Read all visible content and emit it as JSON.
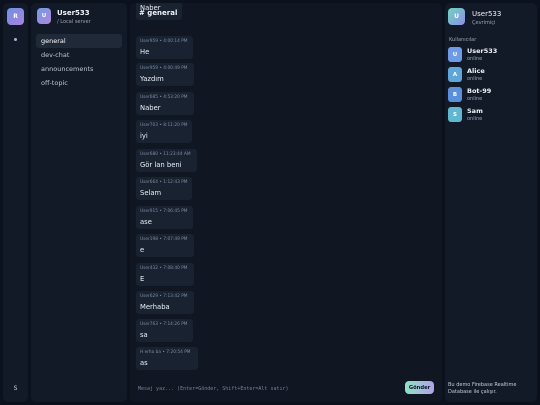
{
  "rail": {
    "server_initial": "R",
    "bottom_label": "S"
  },
  "sidebar": {
    "user_initial": "U",
    "username": "User533",
    "server_label": "/ Local server",
    "channels": [
      {
        "label": "general",
        "active": true
      },
      {
        "label": "dev-chat",
        "active": false
      },
      {
        "label": "announcements",
        "active": false
      },
      {
        "label": "off-topic",
        "active": false
      }
    ]
  },
  "main": {
    "title": "# general",
    "messages": [
      {
        "meta": "",
        "text": "Naber"
      },
      {
        "meta": "User959 • 4:00:14 PM",
        "text": "He"
      },
      {
        "meta": "User959 • 4:00:49 PM",
        "text": "Yazdım"
      },
      {
        "meta": "User685 • 4:53:20 PM",
        "text": "Naber"
      },
      {
        "meta": "User703 • 8:11:20 PM",
        "text": "iyi"
      },
      {
        "meta": "User680 • 11:23:44 AM",
        "text": "Gör lan beni"
      },
      {
        "meta": "User664 • 1:12:43 PM",
        "text": "Selam"
      },
      {
        "meta": "User915 • 7:06:45 PM",
        "text": "ase"
      },
      {
        "meta": "User198 • 7:07:49 PM",
        "text": "e"
      },
      {
        "meta": "User432 • 7:08:40 PM",
        "text": "E"
      },
      {
        "meta": "User629 • 7:13:42 PM",
        "text": "Merhaba"
      },
      {
        "meta": "User763 • 7:14:26 PM",
        "text": "sa"
      },
      {
        "meta": "H erha ba • 7:20:54 PM",
        "text": "as"
      }
    ],
    "composer": {
      "placeholder": "Mesaj yaz... (Enter=Gönder, Shift+Enter=Alt satır)",
      "send_label": "Gönder"
    }
  },
  "right_panel": {
    "user_initial": "U",
    "username": "User533",
    "status": "Çevrimiçi",
    "section_title": "Kullanıcılar",
    "users": [
      {
        "initial": "U",
        "name": "User533",
        "status": "online",
        "color": "#6f9be6"
      },
      {
        "initial": "A",
        "name": "Alice",
        "status": "online",
        "color": "#5fa7d8"
      },
      {
        "initial": "B",
        "name": "Bot-99",
        "status": "online",
        "color": "#5a8fdc"
      },
      {
        "initial": "S",
        "name": "Sam",
        "status": "online",
        "color": "#5fb8d0"
      }
    ],
    "footer": "Bu demo Firebase Realtime Database ile çalışır."
  }
}
